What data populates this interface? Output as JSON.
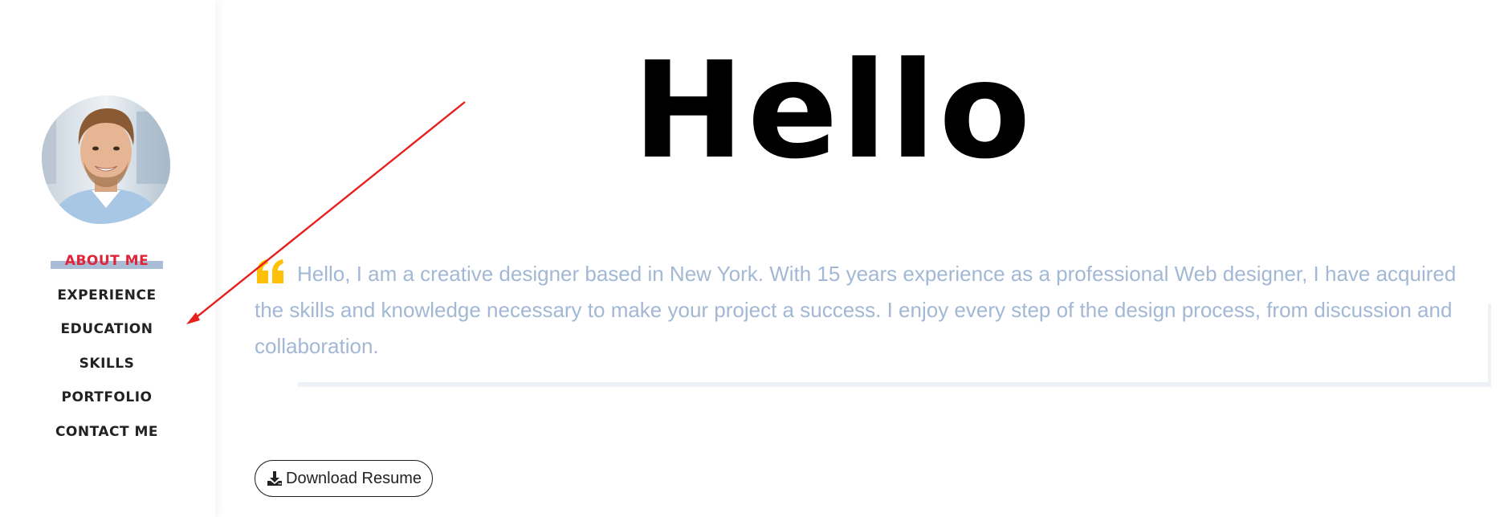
{
  "sidebar": {
    "avatar_icon": "user-portrait-photo",
    "nav": [
      {
        "label": "ABOUT ME",
        "active": true
      },
      {
        "label": "EXPERIENCE",
        "active": false
      },
      {
        "label": "EDUCATION",
        "active": false
      },
      {
        "label": "SKILLS",
        "active": false
      },
      {
        "label": "PORTFOLIO",
        "active": false
      },
      {
        "label": "CONTACT ME",
        "active": false
      }
    ]
  },
  "main": {
    "heading": "Hello",
    "intro": "Hello, I am a creative designer based in New York. With 15 years experience as a professional Web designer, I have acquired the skills and knowledge necessary to make your project a success. I enjoy every step of the design process, from discussion and collaboration.",
    "resume_button": {
      "label": "Download Resume",
      "icon": "download-icon"
    }
  },
  "colors": {
    "active_nav": "#e0243a",
    "active_highlight": "#a9bdd6",
    "intro_text": "#a2b8d4",
    "quote_mark": "#ffc107",
    "annotation_arrow": "#e8201d"
  }
}
